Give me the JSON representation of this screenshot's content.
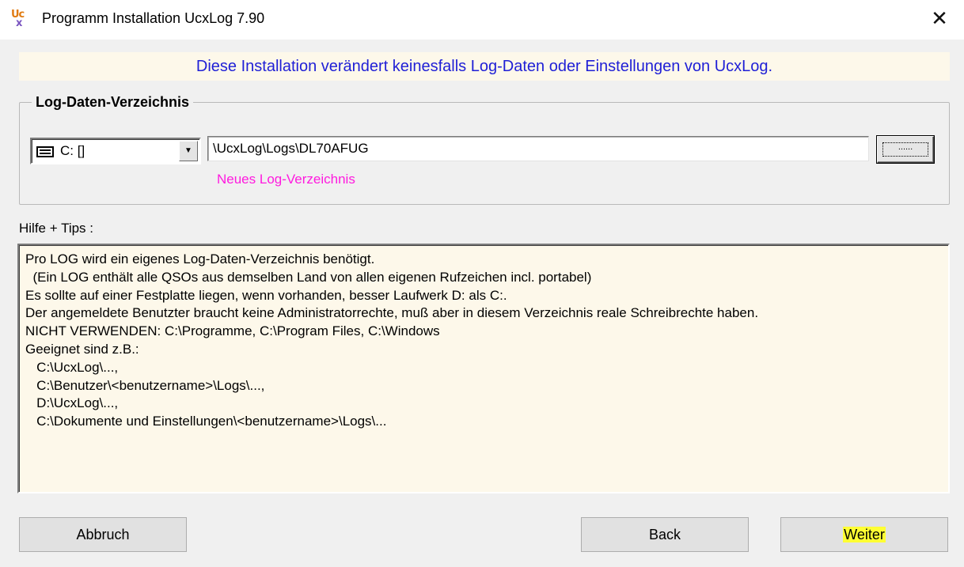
{
  "window": {
    "title": "Programm Installation UcxLog 7.90",
    "icon_text": [
      "Uc",
      "x"
    ],
    "close_glyph": "✕"
  },
  "banner": {
    "text": "Diese Installation verändert keinesfalls Log-Daten oder Einstellungen von UcxLog.",
    "color": "#1f1fd6"
  },
  "log_dir_group": {
    "legend": "Log-Daten-Verzeichnis",
    "drive_select": {
      "value": "C: []",
      "icon": "drive-icon"
    },
    "path_value": "\\UcxLog\\Logs\\DL70AFUG",
    "browse_label": "......",
    "status_text": "Neues Log-Verzeichnis",
    "status_color": "#ff1adf"
  },
  "help": {
    "label": "Hilfe + Tips :",
    "lines": [
      "Pro LOG wird ein eigenes Log-Daten-Verzeichnis benötigt.",
      "  (Ein LOG enthält alle QSOs aus demselben Land von allen eigenen Rufzeichen incl. portabel)",
      "Es sollte auf einer Festplatte liegen, wenn vorhanden, besser Laufwerk D: als C:.",
      "Der angemeldete Benutzter braucht keine Administratorrechte, muß aber in diesem Verzeichnis reale Schreibrechte haben.",
      "NICHT VERWENDEN: C:\\Programme, C:\\Program Files, C:\\Windows",
      "Geeignet sind z.B.:",
      "   C:\\UcxLog\\...,",
      "   C:\\Benutzer\\<benutzername>\\Logs\\...,",
      "   D:\\UcxLog\\...,",
      "   C:\\Dokumente und Einstellungen\\<benutzername>\\Logs\\..."
    ]
  },
  "buttons": {
    "cancel": "Abbruch",
    "back": "Back",
    "next": "Weiter"
  }
}
